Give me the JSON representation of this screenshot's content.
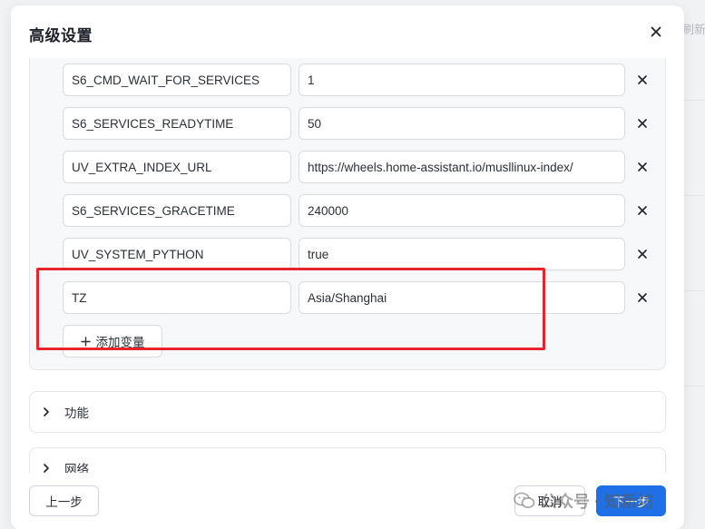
{
  "background": {
    "refresh_label": "刷新"
  },
  "dialog": {
    "title": "高级设置",
    "close_icon": "close-icon"
  },
  "env_vars": [
    {
      "key": "S6_CMD_WAIT_FOR_SERVICES",
      "value": "1"
    },
    {
      "key": "S6_SERVICES_READYTIME",
      "value": "50"
    },
    {
      "key": "UV_EXTRA_INDEX_URL",
      "value": "https://wheels.home-assistant.io/musllinux-index/"
    },
    {
      "key": "S6_SERVICES_GRACETIME",
      "value": "240000"
    },
    {
      "key": "UV_SYSTEM_PYTHON",
      "value": "true"
    },
    {
      "key": "TZ",
      "value": "Asia/Shanghai"
    }
  ],
  "add_variable_label": "添加变量",
  "sections": [
    {
      "label": "功能"
    },
    {
      "label": "网络"
    }
  ],
  "footer": {
    "prev_label": "上一步",
    "cancel_label": "取消",
    "next_label": "下一步"
  },
  "watermark": {
    "text": "公众号 · 知新坊"
  },
  "colors": {
    "primary": "#1f6fe6",
    "highlight": "#e8232b",
    "card_bg": "#f7f8fa"
  }
}
